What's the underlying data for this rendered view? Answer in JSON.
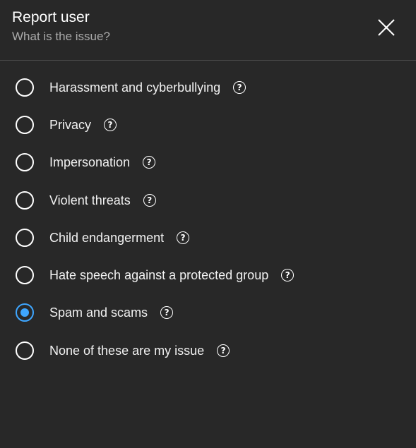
{
  "dialog": {
    "title": "Report user",
    "subtitle": "What is the issue?",
    "close_icon": "close-icon"
  },
  "options": [
    {
      "label": "Harassment and cyberbullying",
      "selected": false,
      "help_icon": "?"
    },
    {
      "label": "Privacy",
      "selected": false,
      "help_icon": "?"
    },
    {
      "label": "Impersonation",
      "selected": false,
      "help_icon": "?"
    },
    {
      "label": "Violent threats",
      "selected": false,
      "help_icon": "?"
    },
    {
      "label": "Child endangerment",
      "selected": false,
      "help_icon": "?"
    },
    {
      "label": "Hate speech against a protected group",
      "selected": false,
      "help_icon": "?"
    },
    {
      "label": "Spam and scams",
      "selected": true,
      "help_icon": "?"
    },
    {
      "label": "None of these are my issue",
      "selected": false,
      "help_icon": "?"
    }
  ],
  "colors": {
    "background": "#282828",
    "accent": "#3ea6ff",
    "subtitle": "#aaaaaa",
    "divider": "#4a4a4a"
  }
}
